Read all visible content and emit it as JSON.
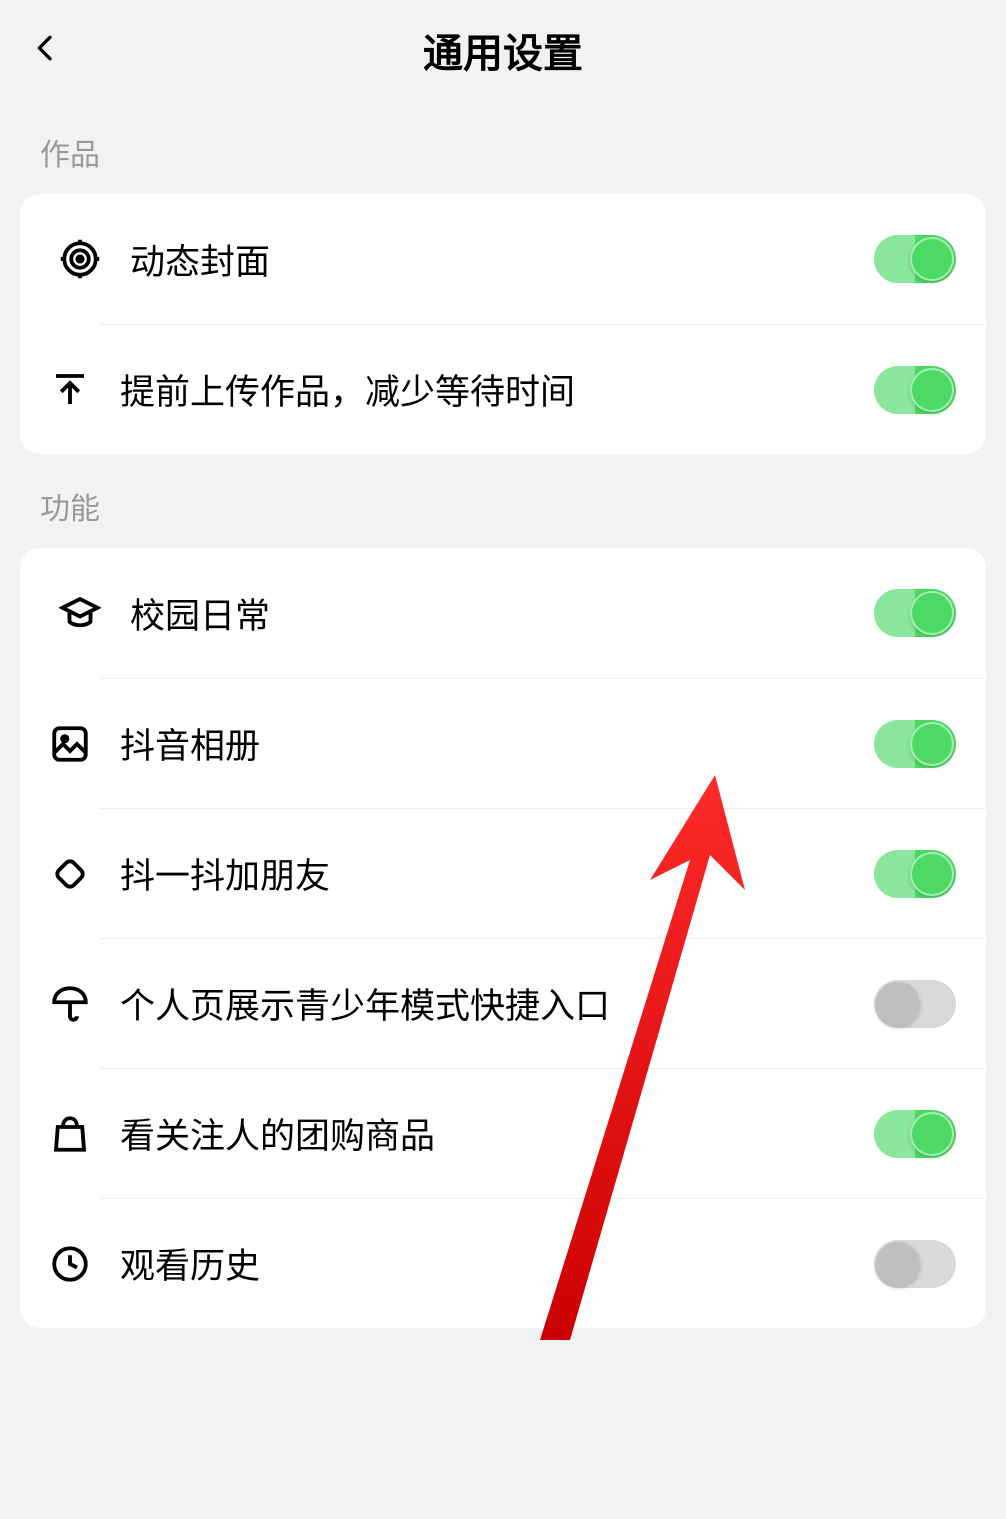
{
  "header": {
    "title": "通用设置"
  },
  "sections": {
    "works": {
      "label": "作品",
      "items": {
        "dynamic_cover": {
          "label": "动态封面",
          "on": true
        },
        "pre_upload": {
          "label": "提前上传作品，减少等待时间",
          "on": true
        }
      }
    },
    "features": {
      "label": "功能",
      "items": {
        "campus_daily": {
          "label": "校园日常",
          "on": true
        },
        "douyin_album": {
          "label": "抖音相册",
          "on": true
        },
        "shake_friends": {
          "label": "抖一抖加朋友",
          "on": true
        },
        "teen_shortcut": {
          "label": "个人页展示青少年模式快捷入口",
          "on": false
        },
        "followed_groupbuy": {
          "label": "看关注人的团购商品",
          "on": true
        },
        "watch_history": {
          "label": "观看历史",
          "on": false
        }
      }
    }
  }
}
